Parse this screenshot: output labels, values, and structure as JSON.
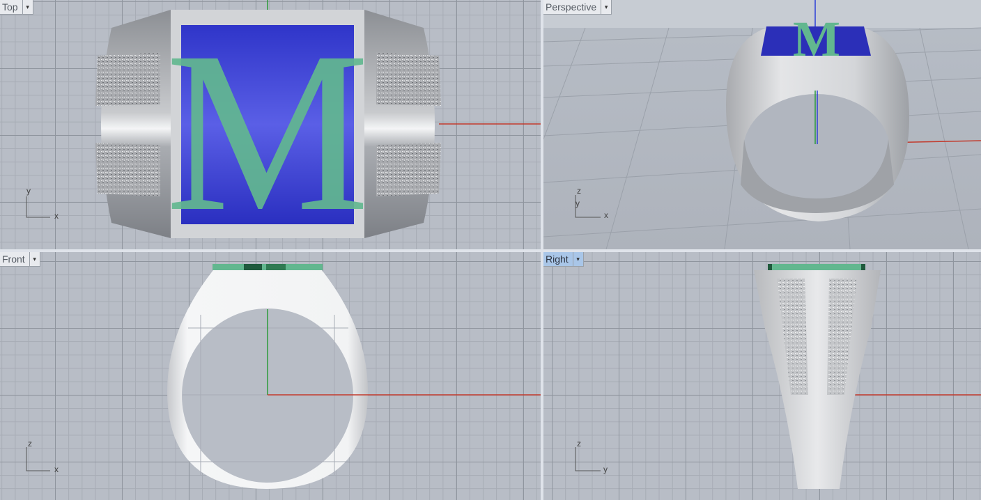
{
  "viewports": {
    "top": {
      "label": "Top",
      "axis_v": "y",
      "axis_h": "x"
    },
    "perspective": {
      "label": "Perspective",
      "axis_z": "z",
      "axis_v": "y",
      "axis_h": "x"
    },
    "front": {
      "label": "Front",
      "axis_v": "z",
      "axis_h": "x"
    },
    "right": {
      "label": "Right",
      "axis_v": "z",
      "axis_h": "y",
      "active": true
    }
  },
  "model": {
    "monogram": "M",
    "colors": {
      "metal": "#c9cbcf",
      "letter": "#62b78f",
      "setting": "#3b3fd6",
      "axis_x": "#c23a2c",
      "axis_y": "#2c9a3a",
      "axis_z": "#2a3fd6"
    }
  },
  "icons": {
    "dropdown": "dropdown-arrow-icon",
    "axis": "axis-triad-icon"
  }
}
